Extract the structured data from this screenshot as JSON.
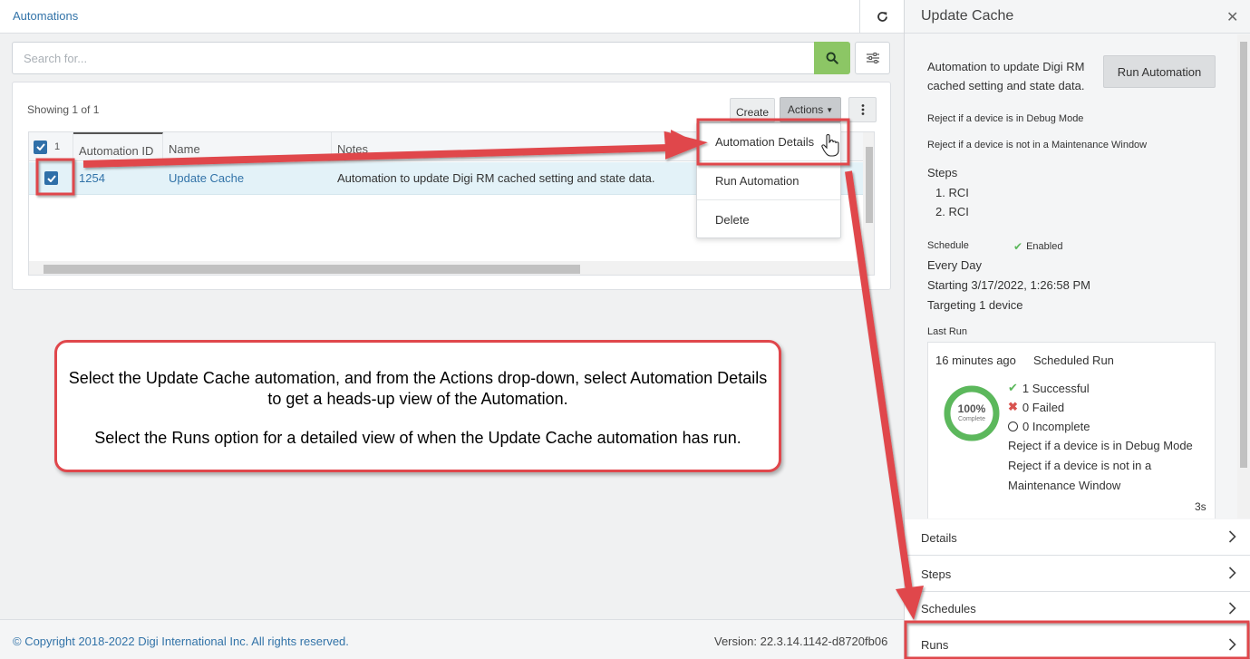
{
  "topbar": {
    "breadcrumb": "Automations",
    "refresh_icon": "refresh-icon"
  },
  "search": {
    "placeholder": "Search for...",
    "search_icon": "search-icon",
    "filter_icon": "sliders-icon"
  },
  "grid": {
    "showing": "Showing 1 of 1",
    "create_label": "Create",
    "actions_label": "Actions",
    "selected_count": "1",
    "columns": [
      "Automation ID",
      "Name",
      "Notes"
    ],
    "rows": [
      {
        "id": "1254",
        "name": "Update Cache",
        "notes": "Automation to update Digi RM cached setting and state data.",
        "selected": true
      }
    ]
  },
  "actions_menu": {
    "items": [
      "Automation Details",
      "Run Automation",
      "Delete"
    ]
  },
  "footer": {
    "copyright": "© Copyright 2018-2022 Digi International Inc. All rights reserved.",
    "version": "Version: 22.3.14.1142-d8720fb06"
  },
  "panel": {
    "title": "Update Cache",
    "description": "Automation to update Digi RM cached setting and state data.",
    "run_button": "Run Automation",
    "reject_debug": "Reject if a device is in Debug Mode",
    "reject_maint": "Reject if a device is not in a Maintenance Window",
    "steps_label": "Steps",
    "steps": [
      "1. RCI",
      "2. RCI"
    ],
    "schedule_label": "Schedule",
    "schedule_status": "Enabled",
    "schedule_freq": "Every Day",
    "schedule_start": "Starting 3/17/2022, 1:26:58 PM",
    "schedule_target": "Targeting 1 device",
    "last_run_label": "Last Run",
    "last_run": {
      "ago": "16 minutes ago",
      "type": "Scheduled Run",
      "percent": "100%",
      "percent_value": 1.0,
      "complete_label": "Complete",
      "successful": "1 Successful",
      "failed": "0 Failed",
      "incomplete": "0 Incomplete",
      "reject_debug": "Reject if a device is in Debug Mode",
      "reject_maint_1": "Reject if a device is not in a",
      "reject_maint_2": "Maintenance Window",
      "duration": "3s"
    },
    "sections": [
      "Details",
      "Steps",
      "Schedules",
      "Runs"
    ]
  },
  "annotation": {
    "line1": "Select the Update Cache automation, and from the Actions drop-down, select Automation Details to get a heads-up view of the Automation.",
    "line2": "Select the Runs option for a detailed view of when the Update Cache automation has run."
  },
  "colors": {
    "link": "#3273a8",
    "search_button": "#8cc665",
    "checkbox": "#2f6fa8",
    "selected_row": "#e3f2f8",
    "highlight": "#e0474c",
    "success": "#5cb85c",
    "danger": "#d9534f"
  }
}
